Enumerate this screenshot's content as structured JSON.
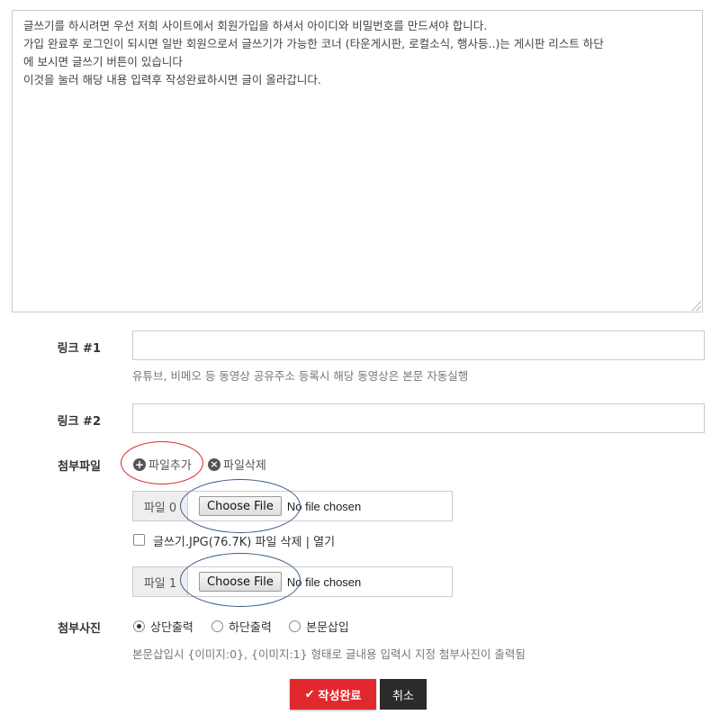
{
  "content": {
    "lines": [
      "글쓰기를 하시려면 우선 저희 사이트에서 회원가입을 하셔서 아이디와 비밀번호를 만드셔야 합니다.",
      "가입 완료후 로그인이 되시면 일반 회원으로서 글쓰기가 가능한 코너 (타운게시판, 로컬소식, 행사등..)는 게시판 리스트 하단",
      "에 보시면 글쓰기 버튼이 있습니다",
      "이것을 눌러 해당 내용 입력후 작성완료하시면 글이 올라갑니다."
    ]
  },
  "link1": {
    "label": "링크 #1",
    "help": "유튜브, 비메오 등 동영상 공유주소 등록시 해당 동영상은 본문 자동실행",
    "value": ""
  },
  "link2": {
    "label": "링크 #2",
    "value": ""
  },
  "attach": {
    "label": "첨부파일",
    "add_label": "파일추가",
    "delete_label": "파일삭제",
    "add_icon": "plus-circle-icon",
    "delete_icon": "x-circle-icon",
    "files": [
      {
        "addon": "파일 0",
        "button": "Choose File",
        "status": "No file chosen"
      },
      {
        "addon": "파일 1",
        "button": "Choose File",
        "status": "No file chosen"
      }
    ],
    "existing_file": "글쓰기.JPG(76.7K) 파일 삭제 | 열기",
    "existing_checked": false
  },
  "photo": {
    "label": "첨부사진",
    "options": [
      {
        "label": "상단출력",
        "checked": true
      },
      {
        "label": "하단출력",
        "checked": false
      },
      {
        "label": "본문삽입",
        "checked": false
      }
    ],
    "help": "본문삽입시 {이미지:0}, {이미지:1} 형태로 글내용 입력시 지정 첨부사진이 출력됨"
  },
  "buttons": {
    "submit": "작성완료",
    "submit_icon": "check-icon",
    "cancel": "취소"
  },
  "colors": {
    "submit_bg": "#e2282f",
    "cancel_bg": "#2b2b2b",
    "annotation_red": "#d9262b",
    "annotation_blue": "#3c5a8a"
  }
}
